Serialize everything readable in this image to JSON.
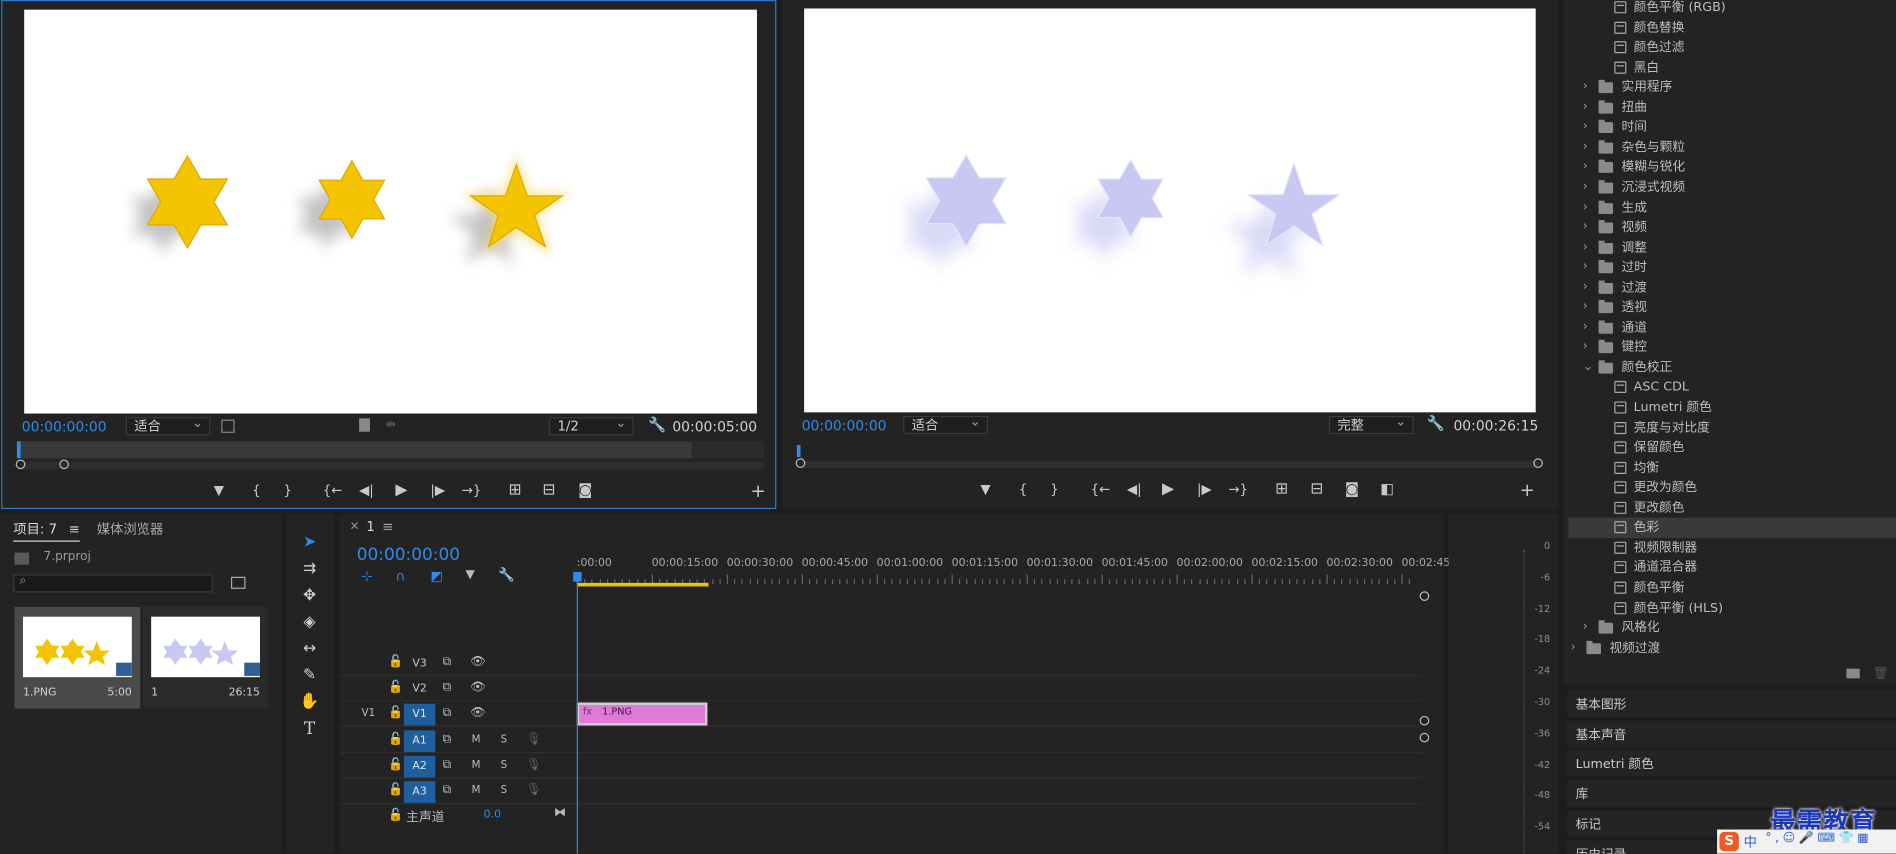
{
  "source_monitor": {
    "timecode": "00:00:00:00",
    "zoom": "适合",
    "resolution": "1/2",
    "duration": "00:00:05:00"
  },
  "program_monitor": {
    "timecode": "00:00:00:00",
    "zoom": "适合",
    "quality": "完整",
    "duration": "00:00:26:15"
  },
  "transport_glyphs": {
    "marker": "▼",
    "in": "{",
    "out": "}",
    "go_in": "{←",
    "step_back": "◀|",
    "play": "▶",
    "step_fwd": "|▶",
    "go_out": "→}",
    "insert": "⊞",
    "overwrite": "⊟",
    "export": "◙",
    "compare": "◧",
    "add": "+"
  },
  "project": {
    "tab_label": "项目: 7",
    "tab_menu": "≡",
    "media_tab": "媒体浏览器",
    "file": "7.prproj",
    "search_placeholder": "",
    "items": [
      {
        "name": "1.PNG",
        "duration": "5:00",
        "color": "#f5c400"
      },
      {
        "name": "1",
        "duration": "26:15",
        "color": "#c9c8f3"
      }
    ]
  },
  "timeline": {
    "close": "×",
    "name": "1",
    "menu": "≡",
    "timecode": "00:00:00:00",
    "ruler_labels": [
      ":00:00",
      "00:00:15:00",
      "00:00:30:00",
      "00:00:45:00",
      "00:01:00:00",
      "00:01:15:00",
      "00:01:30:00",
      "00:01:45:00",
      "00:02:00:00",
      "00:02:15:00",
      "00:02:30:00",
      "00:02:45:"
    ],
    "video_tracks": [
      {
        "label": "V3",
        "src": ""
      },
      {
        "label": "V2",
        "src": ""
      },
      {
        "label": "V1",
        "src": "V1"
      }
    ],
    "audio_tracks": [
      {
        "label": "A1",
        "src": ""
      },
      {
        "label": "A2",
        "src": ""
      },
      {
        "label": "A3",
        "src": ""
      }
    ],
    "m": "M",
    "s": "S",
    "master_label": "主声道",
    "master_value": "0.0",
    "clip_label": "1.PNG",
    "clip_badge": "fx",
    "clip_color": "#e07ad9"
  },
  "audio_meter": {
    "labels": [
      "0",
      "-6",
      "-12",
      "-18",
      "-24",
      "-30",
      "-36",
      "-42",
      "-48",
      "-54"
    ]
  },
  "effects": {
    "rows": [
      {
        "t": "fx",
        "l": "颜色平衡 (RGB)"
      },
      {
        "t": "fx",
        "l": "颜色替换"
      },
      {
        "t": "fx",
        "l": "颜色过滤"
      },
      {
        "t": "fx",
        "l": "黑白"
      },
      {
        "t": "folder",
        "l": "实用程序"
      },
      {
        "t": "folder",
        "l": "扭曲"
      },
      {
        "t": "folder",
        "l": "时间"
      },
      {
        "t": "folder",
        "l": "杂色与颗粒"
      },
      {
        "t": "folder",
        "l": "模糊与锐化"
      },
      {
        "t": "folder",
        "l": "沉浸式视频"
      },
      {
        "t": "folder",
        "l": "生成"
      },
      {
        "t": "folder",
        "l": "视频"
      },
      {
        "t": "folder",
        "l": "调整"
      },
      {
        "t": "folder",
        "l": "过时"
      },
      {
        "t": "folder",
        "l": "过渡"
      },
      {
        "t": "folder",
        "l": "透视"
      },
      {
        "t": "folder",
        "l": "通道"
      },
      {
        "t": "folder",
        "l": "键控"
      },
      {
        "t": "open",
        "l": "颜色校正"
      },
      {
        "t": "fx",
        "l": "ASC CDL"
      },
      {
        "t": "fx",
        "l": "Lumetri 颜色"
      },
      {
        "t": "fx",
        "l": "亮度与对比度"
      },
      {
        "t": "fx",
        "l": "保留颜色"
      },
      {
        "t": "fx",
        "l": "均衡"
      },
      {
        "t": "fx",
        "l": "更改为颜色"
      },
      {
        "t": "fx",
        "l": "更改颜色"
      },
      {
        "t": "fxsel",
        "l": "色彩"
      },
      {
        "t": "fx",
        "l": "视频限制器"
      },
      {
        "t": "fx",
        "l": "通道混合器"
      },
      {
        "t": "fx",
        "l": "颜色平衡"
      },
      {
        "t": "fx",
        "l": "颜色平衡 (HLS)"
      },
      {
        "t": "folder",
        "l": "风格化"
      },
      {
        "t": "top",
        "l": "视频过渡"
      }
    ]
  },
  "side_panels": [
    "基本图形",
    "基本声音",
    "Lumetri 颜色",
    "库",
    "标记",
    "历史记录"
  ],
  "watermark": {
    "text": "最需教育",
    "ime": "中"
  },
  "colors": {
    "accent": "#2d8ceb",
    "star": "#f5c400",
    "star_ghost": "#c9c8f3"
  }
}
